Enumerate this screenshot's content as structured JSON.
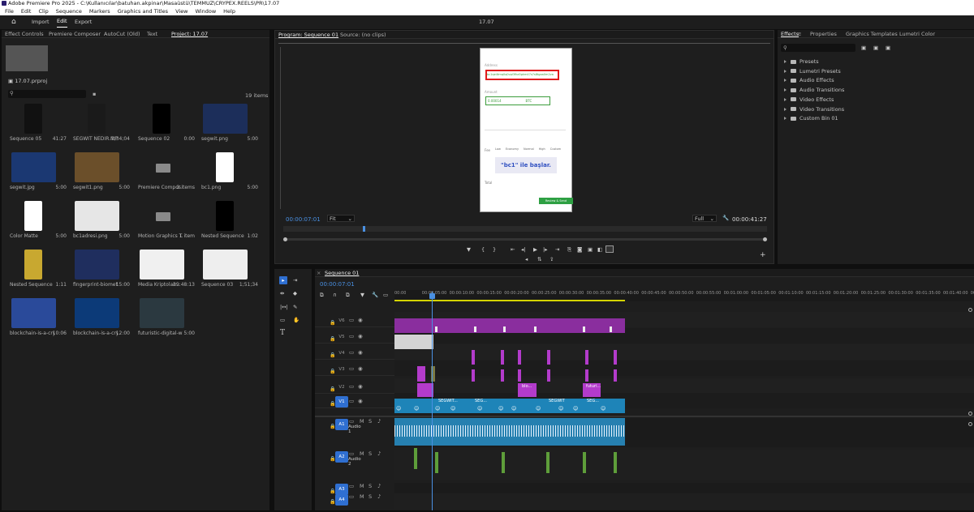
{
  "window": {
    "title": "Adobe Premiere Pro 2025 - C:\\Kullanıcılar\\batuhan.akpinar\\Masaüstü\\TEMMUZ\\CRYPEX.REELS\\PR\\17.07"
  },
  "menu": [
    "File",
    "Edit",
    "Clip",
    "Sequence",
    "Markers",
    "Graphics and Titles",
    "View",
    "Window",
    "Help"
  ],
  "header": {
    "import": "Import",
    "edit": "Edit",
    "export": "Export",
    "center": "17.07"
  },
  "left_tabs": [
    "Effect Controls",
    "Premiere Composer",
    "AutoCut (Old)",
    "Text",
    "Project: 17.07"
  ],
  "project": {
    "file": "17.07.prproj",
    "items_count": "19 items",
    "items": [
      {
        "name": "Sequence 05",
        "dur": "41:27"
      },
      {
        "name": "SEGWIT NEDIR.MP4",
        "dur": "1;34;04"
      },
      {
        "name": "Sequence 02",
        "dur": "0:00"
      },
      {
        "name": "segwit.png",
        "dur": "5:00"
      },
      {
        "name": "segwit.jpg",
        "dur": "5:00"
      },
      {
        "name": "segwit1.png",
        "dur": "5:00"
      },
      {
        "name": "Premiere Compos...",
        "dur": "2 items"
      },
      {
        "name": "bc1.png",
        "dur": "5:00"
      },
      {
        "name": "Color Matte",
        "dur": "5:00"
      },
      {
        "name": "bc1adresi.png",
        "dur": "5:00"
      },
      {
        "name": "Motion Graphics T...",
        "dur": "1 item"
      },
      {
        "name": "Nested Sequence 01",
        "dur": "1:02"
      },
      {
        "name": "Nested Sequence 02",
        "dur": "1:11"
      },
      {
        "name": "fingerprint-biometric...",
        "dur": "15:00"
      },
      {
        "name": "Media Kriptolan...",
        "dur": "29:48:13"
      },
      {
        "name": "Sequence 03",
        "dur": "1;51;34"
      },
      {
        "name": "blockchain-is-a-cryp...",
        "dur": "10:06"
      },
      {
        "name": "blockchain-is-a-cryp...",
        "dur": "12:00"
      },
      {
        "name": "futuristic-digital-wall...",
        "dur": "5:00"
      }
    ]
  },
  "program": {
    "tab": "Program: Sequence 01",
    "source": "Source: (no clips)",
    "timecode": "00:00:07:01",
    "fit": "Fit",
    "quality": "Full",
    "duration": "00:00:41:27"
  },
  "preview": {
    "address_label": "Address",
    "address_value": "bc1qe4tmq0q0vpl3fka5pkm47s7s8tgaa0m2va",
    "amount_label": "Amount",
    "amount_value": "0.00014",
    "unit": "BTC",
    "caption": "\"bc1\" ile başlar.",
    "fee_label": "Fee",
    "fee_opts": [
      "Low",
      "Economy",
      "Normal",
      "High",
      "Custom"
    ],
    "total_label": "Total",
    "button": "Review & Send"
  },
  "effects": {
    "tabs": [
      "Effects",
      "Properties",
      "Graphics Templates",
      "Lumetri Color"
    ],
    "items": [
      "Presets",
      "Lumetri Presets",
      "Audio Effects",
      "Audio Transitions",
      "Video Effects",
      "Video Transitions",
      "Custom Bin 01"
    ]
  },
  "timeline": {
    "tab": "Sequence 01",
    "timecode": "00:00:07:01",
    "ruler": [
      "00:00",
      "00:00:05:00",
      "00:00:10:00",
      "00:00:15:00",
      "00:00:20:00",
      "00:00:25:00",
      "00:00:30:00",
      "00:00:35:00",
      "00:00:40:00",
      "00:00:45:00",
      "00:00:50:00",
      "00:00:55:00",
      "00:01:00:00",
      "00:01:05:00",
      "00:01:10:00",
      "00:01:15:00",
      "00:01:20:00",
      "00:01:25:00",
      "00:01:30:00",
      "00:01:35:00",
      "00:01:40:00",
      "00:01:45:00"
    ],
    "video_tracks": [
      "V6",
      "V5",
      "V4",
      "V3",
      "V2",
      "V1"
    ],
    "audio_tracks": [
      {
        "id": "A1",
        "name": "Audio 1"
      },
      {
        "id": "A2",
        "name": "Audio 2"
      },
      {
        "id": "A3",
        "name": ""
      },
      {
        "id": "A4",
        "name": ""
      }
    ],
    "clip_labels": [
      "SEGWIT...",
      "SEG...",
      "SEGWIT",
      "SEG...",
      "blo...",
      "futuri..."
    ]
  }
}
